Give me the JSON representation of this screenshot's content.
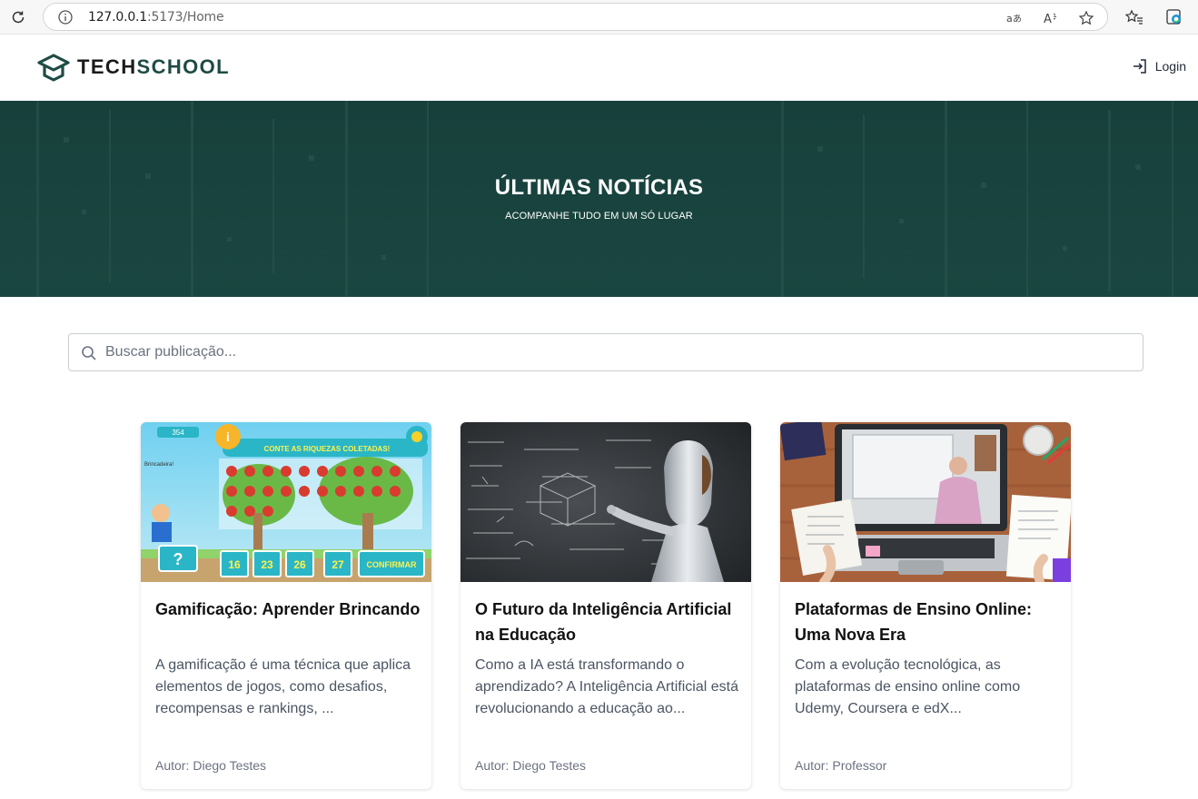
{
  "browser": {
    "url_host": "127.0.0.1",
    "url_rest": ":5173/Home"
  },
  "header": {
    "brand_part1": "TECH",
    "brand_part2": "SCHOOL",
    "login_label": "Login"
  },
  "hero": {
    "title": "ÚLTIMAS NOTÍCIAS",
    "subtitle": "ACOMPANHE TUDO EM UM SÓ LUGAR"
  },
  "search": {
    "placeholder": "Buscar publicação..."
  },
  "author_prefix": "Autor:",
  "posts": [
    {
      "title": "Gamificação: Aprender Brincando",
      "description": "A gamificação é uma técnica que aplica elementos de jogos, como desafios, recompensas e rankings, ...",
      "author": "Diego Testes",
      "image": {
        "banner": "CONTE AS RIQUEZAS COLETADAS!",
        "score": "354",
        "player": "Brincadeira!",
        "question": "?",
        "options": [
          "16",
          "23",
          "26",
          "27"
        ],
        "confirm": "CONFIRMAR"
      }
    },
    {
      "title": "O Futuro da Inteligência Artificial na Educação",
      "description": "Como a IA está transformando o aprendizado? A Inteligência Artificial está revolucionando a educação ao...",
      "author": "Diego Testes"
    },
    {
      "title": "Plataformas de Ensino Online: Uma Nova Era",
      "description": "Com a evolução tecnológica, as plataformas de ensino online como Udemy, Coursera e edX...",
      "author": "Professor"
    }
  ],
  "colors": {
    "brand_green": "#1f4b44",
    "hero_bg": "#17403b"
  }
}
